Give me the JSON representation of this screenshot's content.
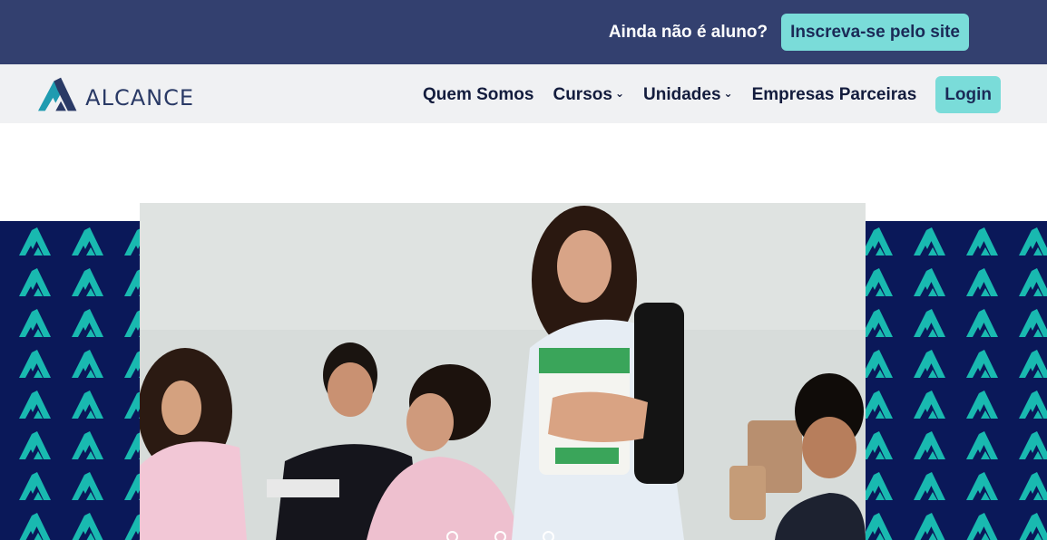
{
  "topbar": {
    "prompt": "Ainda não é aluno?",
    "signup_label": "Inscreva-se pelo site"
  },
  "brand": {
    "name": "ALCANCE",
    "logo_icon": "alcance-mountain-logo",
    "colors": {
      "dark_blue": "#33406f",
      "navy": "#0a1859",
      "teal": "#7adcd9",
      "text": "#131c3d"
    }
  },
  "nav": {
    "items": [
      {
        "label": "Quem Somos",
        "has_dropdown": false
      },
      {
        "label": "Cursos",
        "has_dropdown": true
      },
      {
        "label": "Unidades",
        "has_dropdown": true
      },
      {
        "label": "Empresas Parceiras",
        "has_dropdown": false
      }
    ],
    "login_label": "Login"
  },
  "hero": {
    "image_description_icon": "students-classroom-photo",
    "slide_count": 3
  }
}
